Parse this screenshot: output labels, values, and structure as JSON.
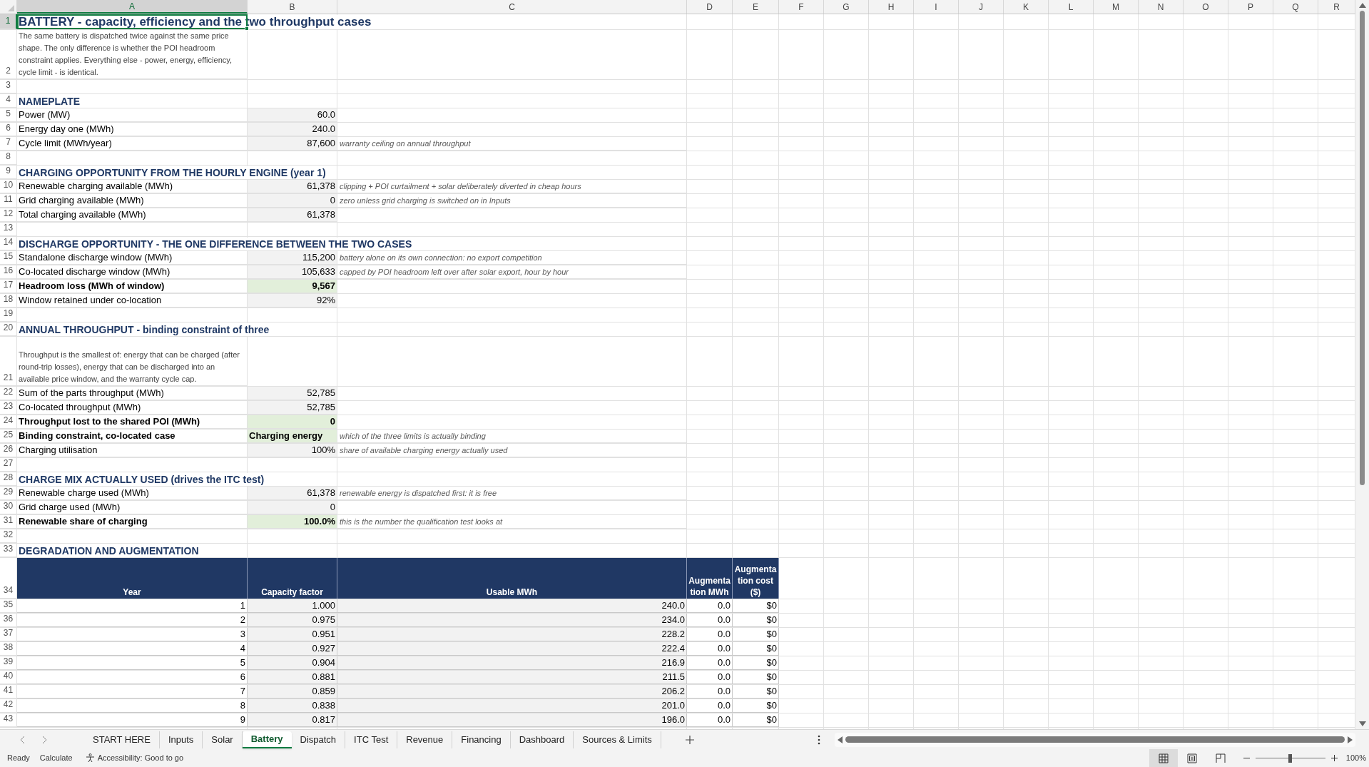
{
  "columns": [
    {
      "label": "A",
      "selected": true
    },
    {
      "label": "B",
      "selected": false
    },
    {
      "label": "C",
      "selected": false
    },
    {
      "label": "D",
      "selected": false
    },
    {
      "label": "E",
      "selected": false
    },
    {
      "label": "F",
      "selected": false
    },
    {
      "label": "G",
      "selected": false
    },
    {
      "label": "H",
      "selected": false
    },
    {
      "label": "I",
      "selected": false
    },
    {
      "label": "J",
      "selected": false
    },
    {
      "label": "K",
      "selected": false
    },
    {
      "label": "L",
      "selected": false
    },
    {
      "label": "M",
      "selected": false
    },
    {
      "label": "N",
      "selected": false
    },
    {
      "label": "O",
      "selected": false
    },
    {
      "label": "P",
      "selected": false
    },
    {
      "label": "Q",
      "selected": false
    },
    {
      "label": "R",
      "selected": false
    }
  ],
  "rows": [
    {
      "number": "1",
      "selected": true,
      "kind": "title",
      "text": "BATTERY - capacity, efficiency and the two throughput cases"
    },
    {
      "number": "2",
      "selected": false,
      "kind": "note",
      "text": "The same battery is dispatched twice against the same price shape. The only difference is whether the POI headroom constraint applies. Everything else - power, energy, efficiency, cycle limit - is identical."
    },
    {
      "number": "3",
      "selected": false,
      "kind": "blank"
    },
    {
      "number": "4",
      "selected": false,
      "kind": "section",
      "text": "NAMEPLATE"
    },
    {
      "number": "5",
      "selected": false,
      "kind": "item",
      "label": "Power (MW)",
      "value": "60.0",
      "bold": false,
      "result": false
    },
    {
      "number": "6",
      "selected": false,
      "kind": "item",
      "label": "Energy day one (MWh)",
      "value": "240.0",
      "bold": false,
      "result": false
    },
    {
      "number": "7",
      "selected": false,
      "kind": "item",
      "label": "Cycle limit (MWh/year)",
      "value": "87,600",
      "comment": "warranty ceiling on annual throughput",
      "bold": false,
      "result": false
    },
    {
      "number": "8",
      "selected": false,
      "kind": "blank"
    },
    {
      "number": "9",
      "selected": false,
      "kind": "section",
      "text": "CHARGING OPPORTUNITY FROM THE HOURLY ENGINE (year 1)"
    },
    {
      "number": "10",
      "selected": false,
      "kind": "item",
      "label": "Renewable charging available (MWh)",
      "value": "61,378",
      "comment": "clipping + POI curtailment + solar deliberately diverted in cheap hours",
      "bold": false,
      "result": false
    },
    {
      "number": "11",
      "selected": false,
      "kind": "item",
      "label": "Grid charging available (MWh)",
      "value": "0",
      "comment": "zero unless grid charging is switched on in Inputs",
      "bold": false,
      "result": false
    },
    {
      "number": "12",
      "selected": false,
      "kind": "item",
      "label": "Total charging available (MWh)",
      "value": "61,378",
      "bold": false,
      "result": false
    },
    {
      "number": "13",
      "selected": false,
      "kind": "blank"
    },
    {
      "number": "14",
      "selected": false,
      "kind": "section",
      "text": "DISCHARGE OPPORTUNITY - THE ONE DIFFERENCE BETWEEN THE TWO CASES"
    },
    {
      "number": "15",
      "selected": false,
      "kind": "item",
      "label": "Standalone discharge window (MWh)",
      "value": "115,200",
      "comment": "battery alone on its own connection: no export competition",
      "bold": false,
      "result": false
    },
    {
      "number": "16",
      "selected": false,
      "kind": "item",
      "label": "Co-located discharge window (MWh)",
      "value": "105,633",
      "comment": "capped by POI headroom left over after solar export, hour by hour",
      "bold": false,
      "result": false
    },
    {
      "number": "17",
      "selected": false,
      "kind": "item",
      "label": "Headroom loss (MWh of window)",
      "value": "9,567",
      "bold": true,
      "result": true
    },
    {
      "number": "18",
      "selected": false,
      "kind": "item",
      "label": "Window retained under co-location",
      "value": "92%",
      "bold": false,
      "result": false
    },
    {
      "number": "19",
      "selected": false,
      "kind": "blank"
    },
    {
      "number": "20",
      "selected": false,
      "kind": "section",
      "text": "ANNUAL THROUGHPUT - binding constraint of three"
    },
    {
      "number": "21",
      "selected": false,
      "kind": "note",
      "text": "Throughput is the smallest of: energy that can be charged (after round-trip losses), energy that can be discharged into an available price window, and the warranty cycle cap."
    },
    {
      "number": "22",
      "selected": false,
      "kind": "item",
      "label": "Sum of the parts throughput (MWh)",
      "value": "52,785",
      "bold": false,
      "result": false
    },
    {
      "number": "23",
      "selected": false,
      "kind": "item",
      "label": "Co-located throughput (MWh)",
      "value": "52,785",
      "bold": false,
      "result": false
    },
    {
      "number": "24",
      "selected": false,
      "kind": "item",
      "label": "Throughput lost to the shared POI (MWh)",
      "value": "0",
      "bold": true,
      "result": true
    },
    {
      "number": "25",
      "selected": false,
      "kind": "item_text",
      "label": "Binding constraint, co-located case",
      "value": "Charging energy",
      "comment": "which of the three limits is actually binding",
      "bold": true,
      "result": true
    },
    {
      "number": "26",
      "selected": false,
      "kind": "item",
      "label": "Charging utilisation",
      "value": "100%",
      "comment": "share of available charging energy actually used",
      "bold": false,
      "result": false
    },
    {
      "number": "27",
      "selected": false,
      "kind": "blank"
    },
    {
      "number": "28",
      "selected": false,
      "kind": "section",
      "text": "CHARGE MIX ACTUALLY USED (drives the ITC test)"
    },
    {
      "number": "29",
      "selected": false,
      "kind": "item",
      "label": "Renewable charge used (MWh)",
      "value": "61,378",
      "comment": "renewable energy is dispatched first: it is free",
      "bold": false,
      "result": false
    },
    {
      "number": "30",
      "selected": false,
      "kind": "item",
      "label": "Grid charge used (MWh)",
      "value": "0",
      "bold": false,
      "result": false
    },
    {
      "number": "31",
      "selected": false,
      "kind": "item",
      "label": "Renewable share of charging",
      "value": "100.0%",
      "comment": "this is the number the qualification test looks at",
      "bold": true,
      "result": true
    },
    {
      "number": "32",
      "selected": false,
      "kind": "blank"
    },
    {
      "number": "33",
      "selected": false,
      "kind": "section",
      "text": "DEGRADATION AND AUGMENTATION"
    },
    {
      "number": "34",
      "selected": false,
      "kind": "table_header",
      "cells": [
        "Year",
        "Capacity factor",
        "Usable MWh",
        "Augmentation MWh",
        "Augmentation cost ($)"
      ]
    },
    {
      "number": "35",
      "selected": false,
      "kind": "table_row",
      "cells": [
        "1",
        "1.000",
        "240.0",
        "0.0",
        "$0"
      ]
    },
    {
      "number": "36",
      "selected": false,
      "kind": "table_row",
      "cells": [
        "2",
        "0.975",
        "234.0",
        "0.0",
        "$0"
      ]
    },
    {
      "number": "37",
      "selected": false,
      "kind": "table_row",
      "cells": [
        "3",
        "0.951",
        "228.2",
        "0.0",
        "$0"
      ]
    },
    {
      "number": "38",
      "selected": false,
      "kind": "table_row",
      "cells": [
        "4",
        "0.927",
        "222.4",
        "0.0",
        "$0"
      ]
    },
    {
      "number": "39",
      "selected": false,
      "kind": "table_row",
      "cells": [
        "5",
        "0.904",
        "216.9",
        "0.0",
        "$0"
      ]
    },
    {
      "number": "40",
      "selected": false,
      "kind": "table_row",
      "cells": [
        "6",
        "0.881",
        "211.5",
        "0.0",
        "$0"
      ]
    },
    {
      "number": "41",
      "selected": false,
      "kind": "table_row",
      "cells": [
        "7",
        "0.859",
        "206.2",
        "0.0",
        "$0"
      ]
    },
    {
      "number": "42",
      "selected": false,
      "kind": "table_row",
      "cells": [
        "8",
        "0.838",
        "201.0",
        "0.0",
        "$0"
      ]
    },
    {
      "number": "43",
      "selected": false,
      "kind": "table_row",
      "cells": [
        "9",
        "0.817",
        "196.0",
        "0.0",
        "$0"
      ]
    }
  ],
  "sheet_tabs": [
    {
      "label": "START HERE",
      "selected": false
    },
    {
      "label": "Inputs",
      "selected": false
    },
    {
      "label": "Solar",
      "selected": false
    },
    {
      "label": "Battery",
      "selected": true
    },
    {
      "label": "Dispatch",
      "selected": false
    },
    {
      "label": "ITC Test",
      "selected": false
    },
    {
      "label": "Revenue",
      "selected": false
    },
    {
      "label": "Financing",
      "selected": false
    },
    {
      "label": "Dashboard",
      "selected": false
    },
    {
      "label": "Sources & Limits",
      "selected": false
    }
  ],
  "status_bar": {
    "mode": "Ready",
    "calculate": "Calculate",
    "accessibility": "Accessibility: Good to go",
    "views": [
      {
        "kind": "normal",
        "selected": true
      },
      {
        "kind": "page_layout",
        "selected": false
      },
      {
        "kind": "page_break",
        "selected": false
      }
    ],
    "zoom": {
      "level": 0.5,
      "reading": "100%"
    }
  }
}
